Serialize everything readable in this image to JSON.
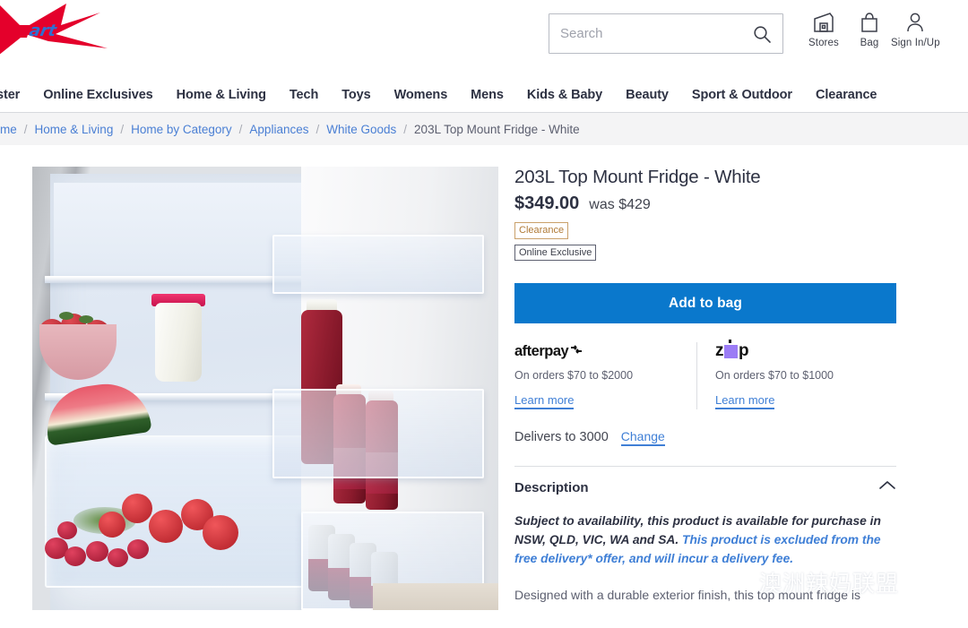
{
  "header": {
    "logo_text": "Kmart",
    "logo_colors": {
      "k": "#e4002b",
      "mart": "#2f6fd0"
    },
    "search": {
      "placeholder": "Search",
      "value": "",
      "icon": "search-icon"
    },
    "utilities": [
      {
        "label": "Stores",
        "icon": "store-icon"
      },
      {
        "label": "Bag",
        "icon": "shopping-bag-icon"
      },
      {
        "label": "Sign In/Up",
        "icon": "user-icon"
      }
    ]
  },
  "nav": {
    "items": [
      {
        "label": "ster"
      },
      {
        "label": "Online Exclusives"
      },
      {
        "label": "Home & Living"
      },
      {
        "label": "Tech"
      },
      {
        "label": "Toys"
      },
      {
        "label": "Womens"
      },
      {
        "label": "Mens"
      },
      {
        "label": "Kids & Baby"
      },
      {
        "label": "Beauty"
      },
      {
        "label": "Sport & Outdoor"
      },
      {
        "label": "Clearance"
      }
    ]
  },
  "breadcrumb": {
    "items": [
      {
        "label": "me",
        "current": false
      },
      {
        "label": "Home & Living",
        "current": false
      },
      {
        "label": "Home by Category",
        "current": false
      },
      {
        "label": "Appliances",
        "current": false
      },
      {
        "label": "White Goods",
        "current": false
      },
      {
        "label": "203L Top Mount Fridge - White",
        "current": true
      }
    ],
    "separator": "/"
  },
  "gallery": {
    "alt": "203L Top Mount Fridge - White, door open showing shelves with strawberries, milk, watermelon, tomatoes, radishes, juice bottles and cans"
  },
  "product": {
    "title": "203L Top Mount Fridge - White",
    "price": "$349.00",
    "was_price": "was $429",
    "badges": [
      {
        "label": "Clearance",
        "color": "#b07a36"
      },
      {
        "label": "Online Exclusive",
        "color": "#3c3f4a"
      }
    ],
    "add_to_bag": "Add to bag",
    "add_to_bag_color": "#0a78cc"
  },
  "payments": [
    {
      "name": "afterpay",
      "logo_text": "afterpay",
      "terms": "On orders $70 to $2000",
      "learn_more": "Learn more"
    },
    {
      "name": "zip",
      "logo_text_left": "z",
      "logo_text_right": "p",
      "terms": "On orders $70 to $1000",
      "learn_more": "Learn more",
      "accent": "#9b7cf5"
    }
  ],
  "delivery": {
    "text": "Delivers to 3000",
    "change_label": "Change"
  },
  "description": {
    "heading": "Description",
    "toggle_icon": "chevron-up-icon",
    "note_black": "Subject to availability, this product is available for purchase in NSW, QLD, VIC, WA and SA.",
    "note_blue": "This product is excluded from the free delivery* offer, and will incur a delivery fee.",
    "paragraph": "Designed with a durable exterior finish, this top mount fridge is"
  },
  "watermark": {
    "text": "澳洲辣妈联盟",
    "icon": "wechat-icon"
  }
}
